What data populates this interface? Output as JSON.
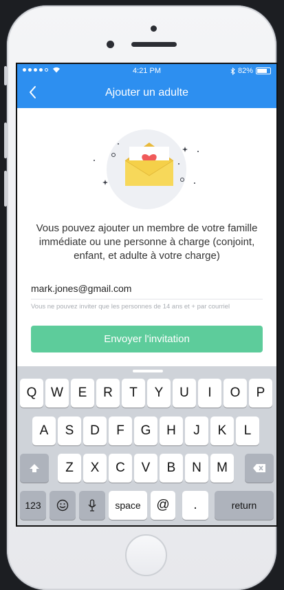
{
  "status_bar": {
    "time": "4:21 PM",
    "battery": "82%"
  },
  "nav": {
    "title": "Ajouter un adulte",
    "back_icon": "chevron-left-icon"
  },
  "illustration": {
    "icon": "envelope-heart-icon",
    "colors": {
      "envelope": "#f5d049",
      "heart": "#f05a5a",
      "circle": "#eef0f4"
    }
  },
  "message": "Vous pouvez ajouter un membre de votre famille immédiate ou une personne à charge (conjoint, enfant, et adulte à votre charge)",
  "email_field": {
    "value": "mark.jones@gmail.com"
  },
  "hint": "Vous ne pouvez inviter que les personnes de 14 ans et + par courriel",
  "send_button": {
    "label": "Envoyer l'invitation",
    "color": "#5dcc9b"
  },
  "keyboard": {
    "row1": [
      "Q",
      "W",
      "E",
      "R",
      "T",
      "Y",
      "U",
      "I",
      "O",
      "P"
    ],
    "row2": [
      "A",
      "S",
      "D",
      "F",
      "G",
      "H",
      "J",
      "K",
      "L"
    ],
    "row3": [
      "Z",
      "X",
      "C",
      "V",
      "B",
      "N",
      "M"
    ],
    "numbers": "123",
    "space": "space",
    "at": "@",
    "period": ".",
    "return": "return",
    "shift_icon": "shift-icon",
    "delete_icon": "backspace-icon",
    "emoji_icon": "emoji-icon",
    "mic_icon": "microphone-icon"
  },
  "colors": {
    "header_blue": "#2d8ff0"
  }
}
